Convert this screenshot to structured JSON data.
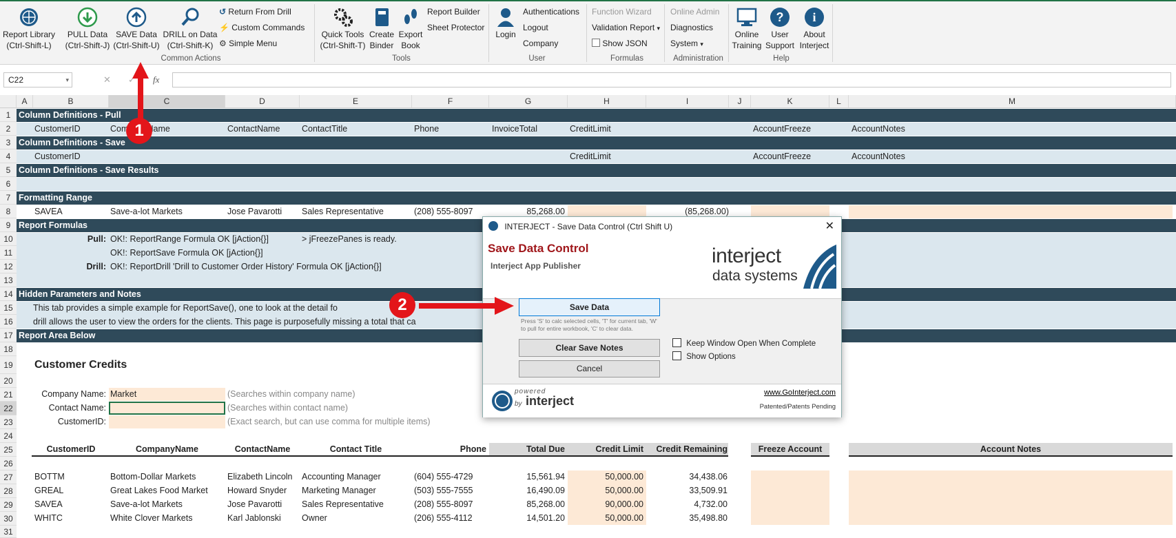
{
  "ribbon": {
    "buttons": [
      {
        "label": "Report Library",
        "shortcut": "(Ctrl-Shift-L)"
      },
      {
        "label": "PULL Data",
        "shortcut": "(Ctrl-Shift-J)"
      },
      {
        "label": "SAVE Data",
        "shortcut": "(Ctrl-Shift-U)"
      },
      {
        "label": "DRILL on Data",
        "shortcut": "(Ctrl-Shift-K)"
      },
      {
        "label": "Quick Tools",
        "shortcut": "(Ctrl-Shift-T)"
      },
      {
        "label": "Create",
        "shortcut": "Binder"
      },
      {
        "label": "Export",
        "shortcut": "Book"
      },
      {
        "label": "Login"
      },
      {
        "label": "Online",
        "shortcut": "Training"
      },
      {
        "label": "User",
        "shortcut": "Support"
      },
      {
        "label": "About",
        "shortcut": "Interject"
      }
    ],
    "small": {
      "return_from_drill": "Return From Drill",
      "custom_commands": "Custom Commands",
      "simple_menu": "Simple Menu",
      "report_builder": "Report Builder",
      "sheet_protector": "Sheet Protector",
      "authentications": "Authentications",
      "logout": "Logout",
      "company": "Company",
      "function_wizard": "Function Wizard",
      "validation_report": "Validation Report",
      "show_json": "Show JSON",
      "online_admin": "Online Admin",
      "diagnostics": "Diagnostics",
      "system": "System"
    },
    "groups": {
      "common_actions": "Common Actions",
      "tools": "Tools",
      "user": "User",
      "formulas": "Formulas",
      "administration": "Administration",
      "help": "Help"
    }
  },
  "formula_bar": {
    "name_box": "C22",
    "fx": "fx",
    "cancel": "✕",
    "enter": "✓"
  },
  "columns": [
    "A",
    "B",
    "C",
    "D",
    "E",
    "F",
    "G",
    "H",
    "I",
    "J",
    "K",
    "L",
    "M"
  ],
  "rows": [
    "1",
    "2",
    "3",
    "4",
    "5",
    "6",
    "7",
    "8",
    "9",
    "10",
    "11",
    "12",
    "13",
    "14",
    "15",
    "16",
    "17",
    "18",
    "19",
    "20",
    "21",
    "22",
    "23",
    "24",
    "25",
    "26",
    "27",
    "28",
    "29",
    "30",
    "31"
  ],
  "bands": {
    "r1": "Column Definitions - Pull",
    "r3": "Column Definitions - Save",
    "r5": "Column Definitions - Save Results",
    "r7": "Formatting Range",
    "r9": "Report Formulas",
    "r14": "Hidden Parameters and Notes",
    "r17": "Report Area Below"
  },
  "row2": [
    "CustomerID",
    "CompanyName",
    "ContactName",
    "ContactTitle",
    "Phone",
    "InvoiceTotal",
    "CreditLimit",
    "AccountFreeze",
    "AccountNotes"
  ],
  "row4": [
    "CustomerID",
    "CreditLimit",
    "AccountFreeze",
    "AccountNotes"
  ],
  "row8": [
    "SAVEA",
    "Save-a-lot Markets",
    "Jose Pavarotti",
    "Sales Representative",
    "(208) 555-8097",
    "85,268.00",
    "(85,268.00)"
  ],
  "formulas": {
    "pull_label": "Pull:",
    "pull_text": "OK!: ReportRange Formula OK [jAction{}]",
    "freeze_text": "> jFreezePanes is ready.",
    "save_text": "OK!: ReportSave Formula OK [jAction{}]",
    "drill_label": "Drill:",
    "drill_text": "OK!: ReportDrill 'Drill to Customer Order History' Formula OK [jAction{}]"
  },
  "notes": {
    "r15": "This tab provides a simple example for ReportSave(), one to look at the detail fo",
    "r16": "drill allows the user to view the orders for the clients.   This page is purposefully missing a total that ca"
  },
  "report": {
    "title": "Customer Credits",
    "company_label": "Company Name:",
    "company_value": "Market",
    "company_hint": "(Searches within company name)",
    "contact_label": "Contact Name:",
    "contact_hint": "(Searches within contact name)",
    "customerid_label": "CustomerID:",
    "customerid_hint": "(Exact search, but can use comma for multiple items)",
    "headers": [
      "CustomerID",
      "CompanyName",
      "ContactName",
      "Contact Title",
      "Phone",
      "Total Due",
      "Credit Limit",
      "Credit Remaining",
      "Freeze Account",
      "Account Notes"
    ],
    "rows": [
      [
        "BOTTM",
        "Bottom-Dollar Markets",
        "Elizabeth Lincoln",
        "Accounting Manager",
        "(604) 555-4729",
        "15,561.94",
        "50,000.00",
        "34,438.06"
      ],
      [
        "GREAL",
        "Great Lakes Food Market",
        "Howard Snyder",
        "Marketing Manager",
        "(503) 555-7555",
        "16,490.09",
        "50,000.00",
        "33,509.91"
      ],
      [
        "SAVEA",
        "Save-a-lot Markets",
        "Jose Pavarotti",
        "Sales Representative",
        "(208) 555-8097",
        "85,268.00",
        "90,000.00",
        "4,732.00"
      ],
      [
        "WHITC",
        "White Clover Markets",
        "Karl Jablonski",
        "Owner",
        "(206) 555-4112",
        "14,501.20",
        "50,000.00",
        "35,498.80"
      ]
    ]
  },
  "dialog": {
    "title": "INTERJECT - Save Data Control  (Ctrl Shift U)",
    "heading": "Save Data Control",
    "subheading": "Interject App Publisher",
    "logo_line1": "interject",
    "logo_line2": "data systems",
    "save_button": "Save Data",
    "hint": "Press 'S' to calc selected cells, 'T' for current tab, 'W' to pull for entire workbook, 'C' to clear data.",
    "clear_button": "Clear Save Notes",
    "cancel_button": "Cancel",
    "keep_open": "Keep Window Open When Complete",
    "show_options": "Show Options",
    "powered": "powered",
    "by": "by",
    "brand": "interject",
    "link": "www.GoInterject.com",
    "patent": "Patented/Patents Pending"
  },
  "annotations": {
    "one": "1",
    "two": "2"
  },
  "colors": {
    "band": "#2f4a5a",
    "band_light": "#dbe7ee",
    "peach": "#fde9d6",
    "title_red": "#a0171b",
    "annotation_red": "#e3151a",
    "brand_blue": "#1e5a8a"
  }
}
